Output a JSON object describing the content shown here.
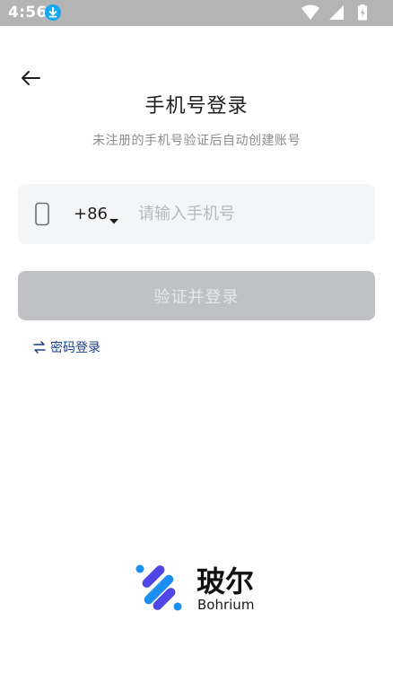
{
  "status_bar": {
    "time": "4:56",
    "icons": [
      "download-icon",
      "wifi-icon",
      "signal-icon",
      "battery-icon"
    ]
  },
  "header": {
    "back_icon": "arrow-left-icon"
  },
  "login": {
    "title": "手机号登录",
    "subtitle": "未注册的手机号验证后自动创建账号",
    "country_code": "+86",
    "phone_placeholder": "请输入手机号",
    "submit_label": "验证并登录",
    "password_login_label": "密码登录"
  },
  "brand": {
    "name_cn": "玻尔",
    "name_en": "Bohrium"
  },
  "colors": {
    "status_bar": "#b4b4b4",
    "download_badge": "#12a9f1",
    "input_background": "#f4f5f7",
    "button_disabled": "#bfc1c5",
    "button_text_disabled": "#e6e7e9",
    "link": "#1d3f8f",
    "subtitle": "#8a8c90",
    "brand_blue": "#1a8ff0",
    "brand_indigo": "#4f46e5"
  }
}
